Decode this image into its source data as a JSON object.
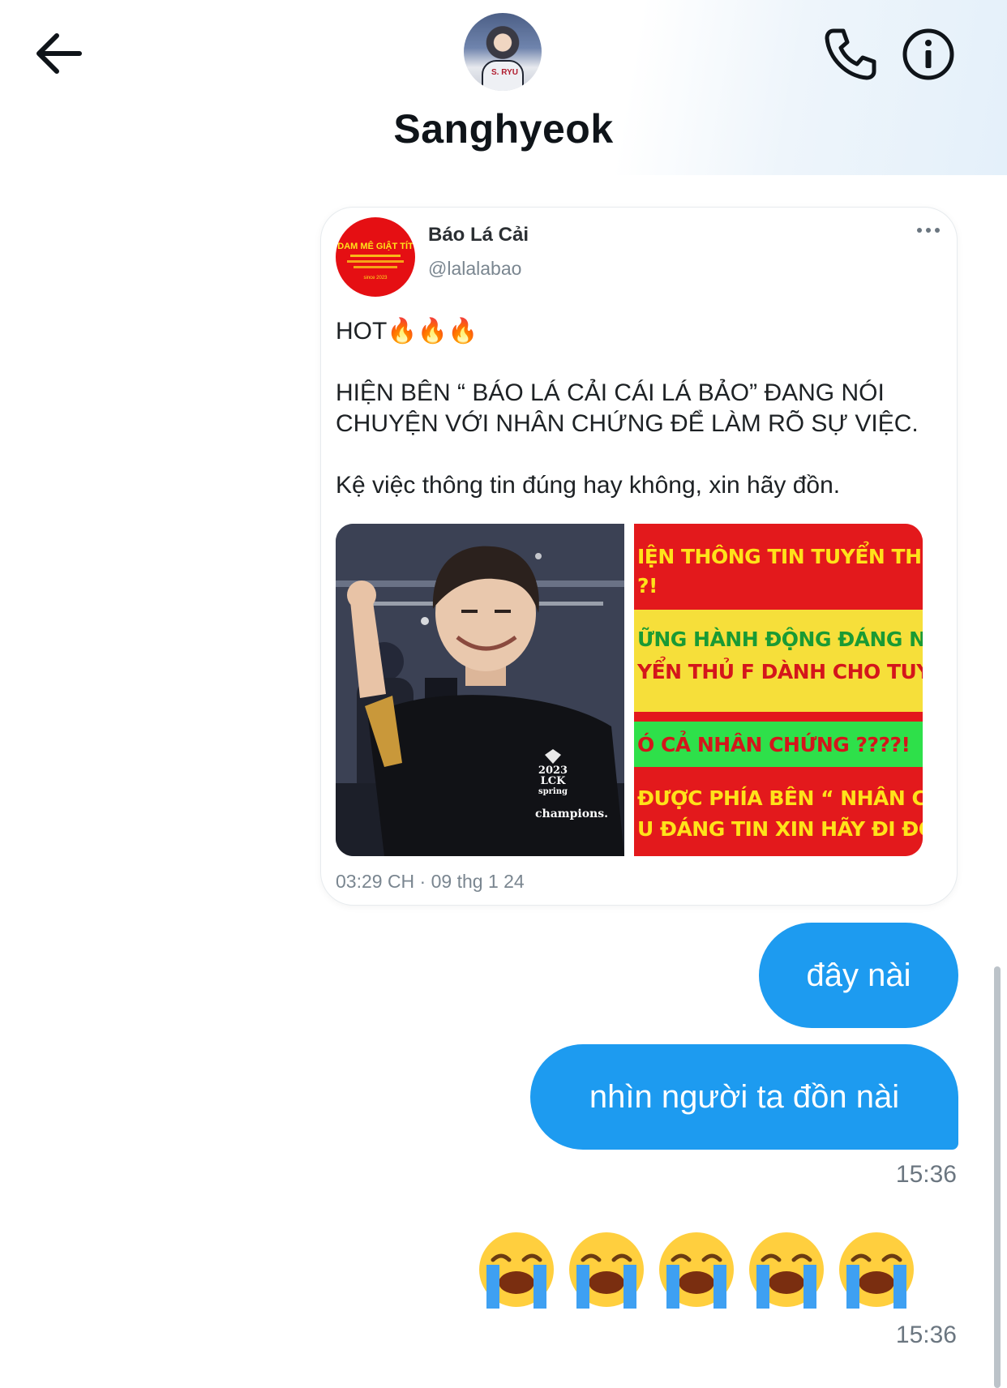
{
  "header": {
    "contact_name": "Sanghyeok",
    "avatar_shirt_text": "S. RYU"
  },
  "tweet": {
    "author_name": "Báo Lá Cải",
    "author_handle": "@lalalabao",
    "avatar_text": "DAM MÊ GIẬT TÍT",
    "avatar_subtext": "since 2023",
    "paragraphs": [
      "HOT🔥🔥🔥",
      "HIỆN BÊN “ BÁO LÁ CẢI CÁI LÁ BẢO” ĐANG NÓI\nCHUYỆN VỚI NHÂN CHỨNG ĐỂ LÀM RÕ SỰ VIỆC.",
      "Kệ việc thông tin đúng hay không, xin hãy đồn."
    ],
    "image2_lines": [
      "IỆN THÔNG TIN TUYỂN THỦ F",
      "?!",
      "ỮNG HÀNH ĐỘNG ĐÁNG NGỜ",
      "YỂN THỦ F DÀNH CHO TUYỂN",
      "Ó CẢ NHÂN CHỨNG ????!",
      "ĐƯỢC PHÍA BÊN “ NHÂN CHỨ",
      "U ĐÁNG TIN XIN HÃY ĐI ĐỒN"
    ],
    "image1_shirt_lines": [
      "2023",
      "LCK",
      "spring",
      "champions."
    ],
    "timestamp": "03:29 CH · 09 thg 1 24"
  },
  "messages": [
    {
      "text": "đây nài"
    },
    {
      "text": "nhìn người ta đồn nài"
    }
  ],
  "time_labels": [
    "15:36",
    "15:36"
  ],
  "emoji_message": {
    "emoji": "😭",
    "count": 5
  },
  "colors": {
    "bubble": "#1d9bf0",
    "tweet_avatar": "#e50f13",
    "banner_red": "#e3191c",
    "banner_yellow": "#f6df3a",
    "banner_green": "#2ee04a"
  },
  "icons": [
    "back-arrow-icon",
    "phone-icon",
    "info-icon",
    "more-dots-icon",
    "loudly-crying-face-emoji"
  ]
}
